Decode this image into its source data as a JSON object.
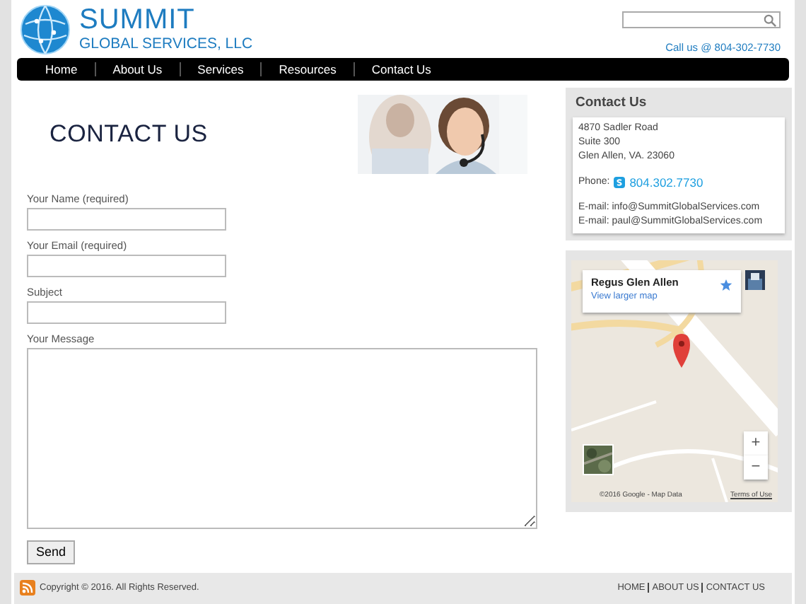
{
  "header": {
    "logo_title": "SUMMIT",
    "logo_subtitle": "GLOBAL SERVICES, LLC",
    "call": "Call us @ 804-302-7730"
  },
  "nav": [
    "Home",
    "About Us",
    "Services",
    "Resources",
    "Contact Us"
  ],
  "page_title": "CONTACT US",
  "form": {
    "fields": [
      {
        "label": "Your Name (required)",
        "kind": "input"
      },
      {
        "label": "Your Email (required)",
        "kind": "input"
      },
      {
        "label": "Subject",
        "kind": "input"
      },
      {
        "label": "Your Message",
        "kind": "textarea"
      }
    ],
    "submit": "Send"
  },
  "sidebar": {
    "contact": {
      "title": "Contact Us",
      "address": [
        "4870 Sadler Road",
        "Suite 300",
        "Glen Allen, VA. 23060"
      ],
      "phone_label": "Phone:",
      "phone": "804.302.7730",
      "emails": [
        "E-mail: info@SummitGlobalServices.com",
        "E-mail: paul@SummitGlobalServices.com"
      ]
    },
    "map": {
      "place": "Regus Glen Allen",
      "link": "View larger map",
      "zoom_in": "+",
      "zoom_out": "−",
      "attribution": "©2016 Google - Map Data",
      "terms": "Terms of Use"
    }
  },
  "footer": {
    "copyright": "Copyright © 2016. All Rights Reserved.",
    "links": [
      "HOME",
      "ABOUT US",
      "CONTACT US"
    ]
  }
}
